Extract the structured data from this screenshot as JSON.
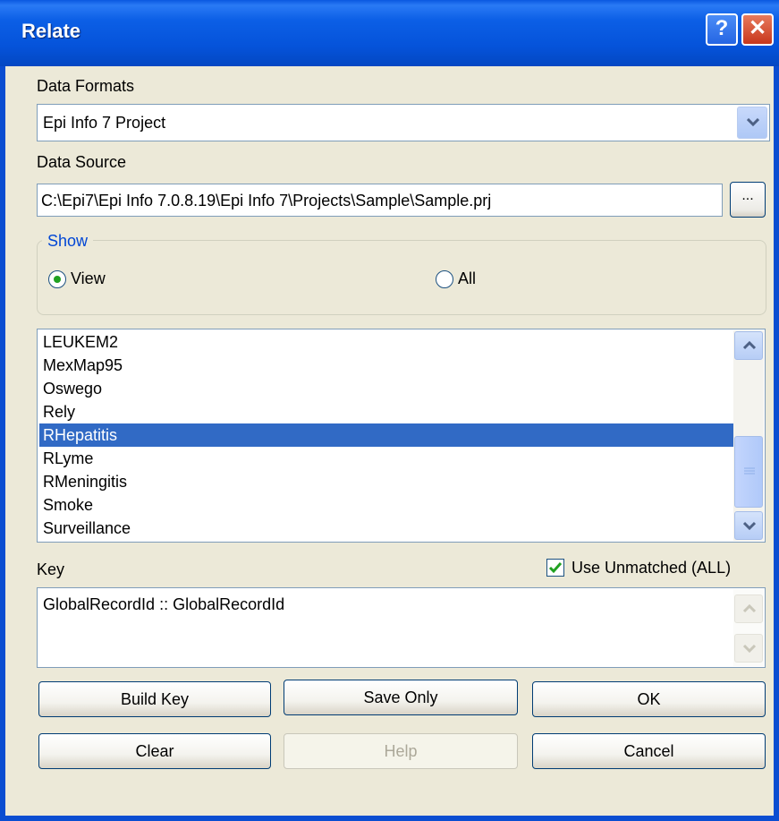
{
  "window": {
    "title": "Relate",
    "help_glyph": "?",
    "close_glyph": "✕"
  },
  "data_formats": {
    "label": "Data Formats",
    "selected": "Epi Info 7 Project"
  },
  "data_source": {
    "label": "Data Source",
    "value": "C:\\Epi7\\Epi Info 7.0.8.19\\Epi Info 7\\Projects\\Sample\\Sample.prj",
    "browse_label": "..."
  },
  "show": {
    "legend": "Show",
    "options": [
      {
        "label": "View",
        "checked": true
      },
      {
        "label": "All",
        "checked": false
      }
    ]
  },
  "views": {
    "items": [
      "LEUKEM2",
      "MexMap95",
      "Oswego",
      "Rely",
      "RHepatitis",
      "RLyme",
      "RMeningitis",
      "Smoke",
      "Surveillance"
    ],
    "selected": "RHepatitis"
  },
  "key": {
    "label": "Key",
    "value": "GlobalRecordId :: GlobalRecordId"
  },
  "use_unmatched": {
    "label": "Use Unmatched (ALL)",
    "checked": true
  },
  "buttons": {
    "build_key": "Build Key",
    "save_only": "Save Only",
    "ok": "OK",
    "clear": "Clear",
    "help": "Help",
    "cancel": "Cancel"
  },
  "colors": {
    "title_bar": "#0553da",
    "selection": "#316ac5",
    "group_legend": "#0046d5",
    "dialog_bg": "#ece9d8"
  }
}
